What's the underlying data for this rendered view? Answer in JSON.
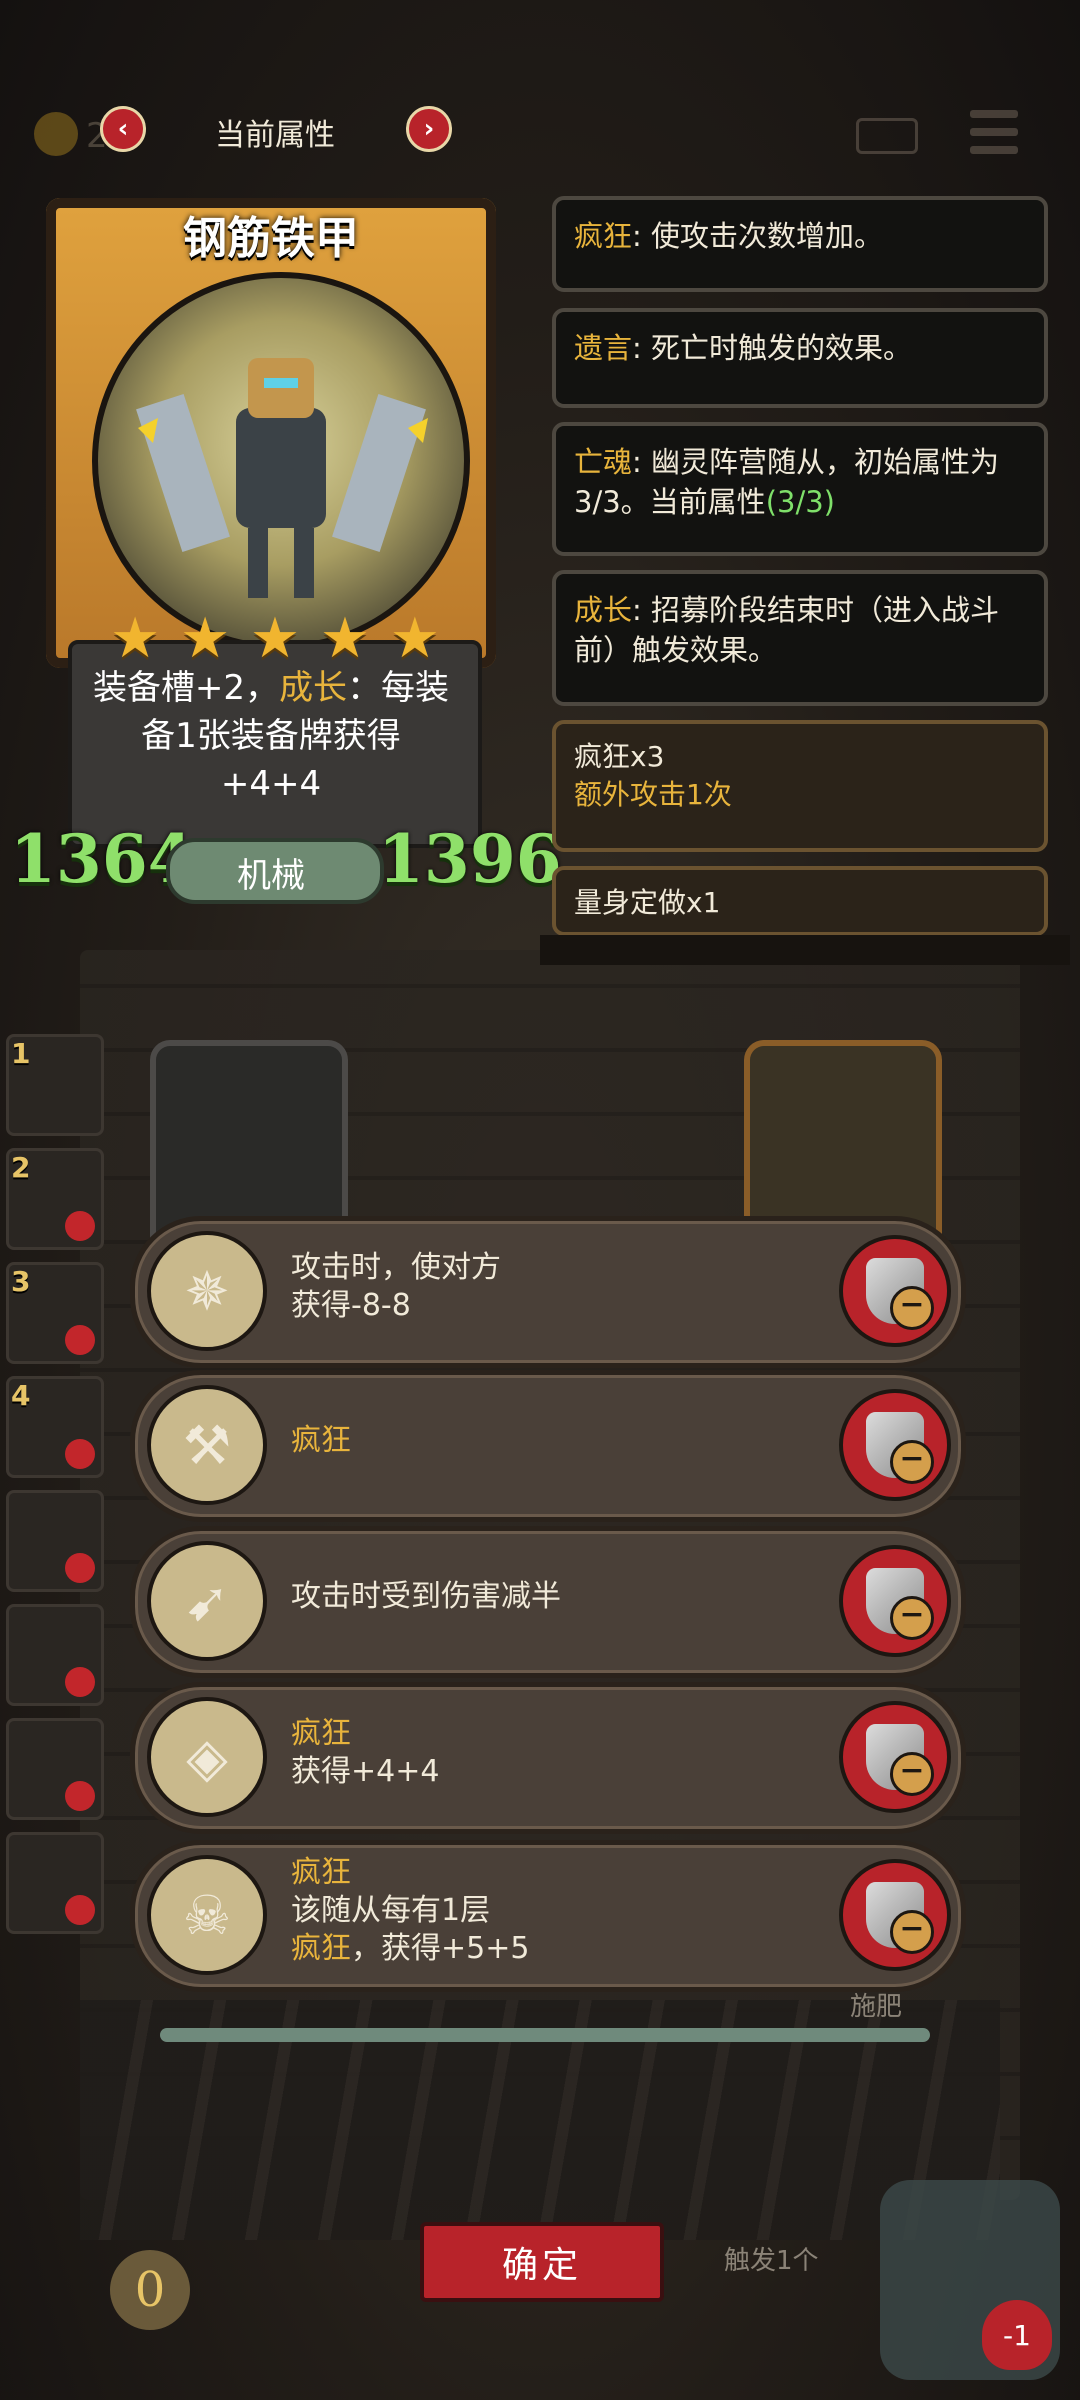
{
  "topbar": {
    "gold": "2",
    "title": "当前属性",
    "prev_icon": "chevron-left-icon",
    "next_icon": "chevron-right-icon"
  },
  "card": {
    "name": "钢筋铁甲",
    "stars": 5,
    "desc_1": "装备槽+2，",
    "desc_kw": "成长",
    "desc_2": "：每装备1张装备牌获得",
    "desc_3": "+4+4",
    "attack": "1364",
    "health": "1396",
    "tribe": "机械"
  },
  "keywords": [
    {
      "kw": "疯狂",
      "text": ": 使攻击次数增加。"
    },
    {
      "kw": "遗言",
      "text": ": 死亡时触发的效果。"
    },
    {
      "kw": "亡魂",
      "text": ": 幽灵阵营随从，初始属性为3/3。当前属性",
      "extra": "(3/3)"
    },
    {
      "kw": "成长",
      "text": ": 招募阶段结束时（进入战斗前）触发效果。"
    }
  ],
  "buffs": [
    {
      "title": "疯狂x3",
      "sub": "额外攻击1次"
    },
    {
      "title": "量身定做x1"
    }
  ],
  "roster": [
    "1",
    "2",
    "3",
    "4",
    "",
    "",
    "",
    ""
  ],
  "equipment": [
    {
      "icon": "mace-icon",
      "line1": "攻击时，使对方",
      "line2": "获得-8-8"
    },
    {
      "icon": "axe-icon",
      "kw": "疯狂"
    },
    {
      "icon": "crossbow-icon",
      "line1": "攻击时受到伤害减半"
    },
    {
      "icon": "crystal-icon",
      "kw": "疯狂",
      "line2": "获得+4+4"
    },
    {
      "icon": "skull-plant-icon",
      "kw": "疯狂",
      "line2": "该随从每有1层",
      "kw2": "疯狂",
      "line3": "，获得+5+5"
    }
  ],
  "hand": {
    "fertilize_label": "施肥",
    "confirm_label": "确定",
    "trigger_label": "触发1个",
    "gold_counter": "0",
    "hero_hp": "-1"
  },
  "colors": {
    "accent": "#e8b43c",
    "stat_green": "#8fe06a",
    "button_red": "#b8232a"
  }
}
